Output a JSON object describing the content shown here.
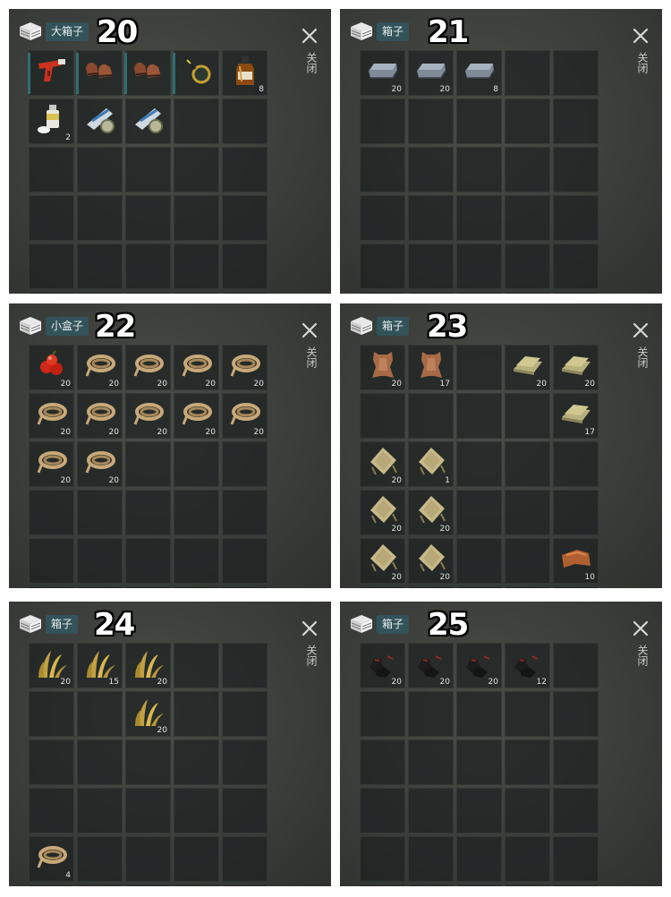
{
  "close_label": "关闭",
  "panels": [
    {
      "title": "大箱子",
      "number": "20",
      "slots": [
        {
          "icon": "flare-gun-icon",
          "qty": "",
          "equipped": true
        },
        {
          "icon": "boots-icon",
          "qty": "",
          "equipped": true
        },
        {
          "icon": "boots-icon",
          "qty": "",
          "equipped": true
        },
        {
          "icon": "magnifying-glass-icon",
          "qty": "",
          "equipped": true
        },
        {
          "icon": "whiskey-bottle-icon",
          "qty": "8"
        },
        {
          "icon": "spray-can-icon",
          "qty": "2"
        },
        {
          "icon": "bandage-roll-icon",
          "qty": ""
        },
        {
          "icon": "bandage-roll-icon",
          "qty": ""
        },
        {},
        {},
        {},
        {},
        {},
        {},
        {},
        {},
        {},
        {},
        {},
        {},
        {},
        {},
        {},
        {},
        {},
        {},
        {},
        {},
        {},
        {}
      ]
    },
    {
      "title": "箱子",
      "number": "21",
      "slots": [
        {
          "icon": "metal-ingot-icon",
          "qty": "20"
        },
        {
          "icon": "metal-ingot-icon",
          "qty": "20"
        },
        {
          "icon": "metal-ingot-icon",
          "qty": "8"
        },
        {},
        {},
        {},
        {},
        {},
        {},
        {},
        {},
        {},
        {},
        {},
        {},
        {},
        {},
        {},
        {},
        {},
        {},
        {},
        {},
        {},
        {},
        {},
        {},
        {},
        {},
        {}
      ]
    },
    {
      "title": "小盒子",
      "number": "22",
      "slots": [
        {
          "icon": "berries-icon",
          "qty": "20"
        },
        {
          "icon": "rope-icon",
          "qty": "20"
        },
        {
          "icon": "rope-icon",
          "qty": "20"
        },
        {
          "icon": "rope-icon",
          "qty": "20"
        },
        {
          "icon": "rope-icon",
          "qty": "20"
        },
        {
          "icon": "rope-icon",
          "qty": "20"
        },
        {
          "icon": "rope-icon",
          "qty": "20"
        },
        {
          "icon": "rope-icon",
          "qty": "20"
        },
        {
          "icon": "rope-icon",
          "qty": "20"
        },
        {
          "icon": "rope-icon",
          "qty": "20"
        },
        {
          "icon": "rope-icon",
          "qty": "20"
        },
        {
          "icon": "rope-icon",
          "qty": "20"
        },
        {},
        {},
        {},
        {},
        {},
        {},
        {},
        {},
        {},
        {},
        {},
        {},
        {},
        {},
        {},
        {},
        {},
        {}
      ]
    },
    {
      "title": "箱子",
      "number": "23",
      "slots": [
        {
          "icon": "animal-hide-icon",
          "qty": "20"
        },
        {
          "icon": "animal-hide-icon",
          "qty": "17"
        },
        {},
        {
          "icon": "folded-cloth-icon",
          "qty": "20"
        },
        {
          "icon": "folded-cloth-icon",
          "qty": "20"
        },
        {},
        {},
        {},
        {},
        {
          "icon": "folded-cloth-icon",
          "qty": "17"
        },
        {
          "icon": "burlap-icon",
          "qty": "20"
        },
        {
          "icon": "burlap-icon",
          "qty": "1"
        },
        {},
        {},
        {},
        {
          "icon": "burlap-icon",
          "qty": "20"
        },
        {
          "icon": "burlap-icon",
          "qty": "20"
        },
        {},
        {},
        {},
        {
          "icon": "burlap-icon",
          "qty": "20"
        },
        {
          "icon": "burlap-icon",
          "qty": "20"
        },
        {},
        {},
        {
          "icon": "leather-scrap-icon",
          "qty": "10"
        },
        {},
        {},
        {},
        {},
        {}
      ]
    },
    {
      "title": "箱子",
      "number": "24",
      "slots": [
        {
          "icon": "dry-grass-icon",
          "qty": "20"
        },
        {
          "icon": "dry-grass-icon",
          "qty": "15"
        },
        {
          "icon": "dry-grass-icon",
          "qty": "20"
        },
        {},
        {},
        {},
        {},
        {
          "icon": "dry-grass-icon",
          "qty": "20"
        },
        {},
        {},
        {},
        {},
        {},
        {},
        {},
        {},
        {},
        {},
        {},
        {},
        {
          "icon": "rope-icon",
          "qty": "4"
        },
        {},
        {},
        {},
        {},
        {},
        {},
        {},
        {},
        {}
      ]
    },
    {
      "title": "箱子",
      "number": "25",
      "slots": [
        {
          "icon": "coal-icon",
          "qty": "20"
        },
        {
          "icon": "coal-icon",
          "qty": "20"
        },
        {
          "icon": "coal-icon",
          "qty": "20"
        },
        {
          "icon": "coal-icon",
          "qty": "12"
        },
        {},
        {},
        {},
        {},
        {},
        {},
        {},
        {},
        {},
        {},
        {},
        {},
        {},
        {},
        {},
        {},
        {},
        {},
        {},
        {},
        {},
        {},
        {},
        {},
        {},
        {}
      ]
    }
  ]
}
